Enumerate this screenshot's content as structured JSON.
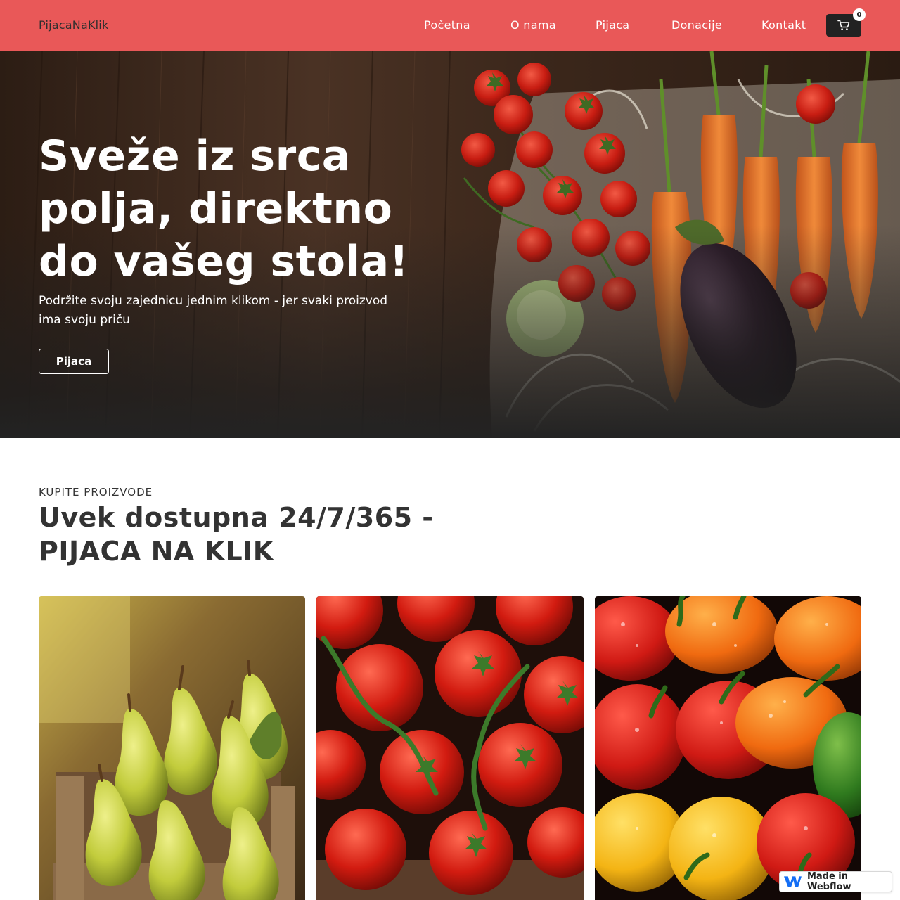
{
  "nav": {
    "brand": "PijacaNaKlik",
    "links": [
      "Početna",
      "O nama",
      "Pijaca",
      "Donacije",
      "Kontakt"
    ],
    "cart_count": "0",
    "accent": "#e95858"
  },
  "hero": {
    "title_line1": "Sveže iz srca",
    "title_line2": "polja, direktno",
    "title_line3": "do vašeg stola!",
    "subtitle_line1": "Podržite svoju zajednicu jednim klikom - jer svaki proizvod",
    "subtitle_line2": "ima svoju priču",
    "button": "Pijaca"
  },
  "products": {
    "eyebrow": "KUPITE PROIZVODE",
    "title_line1": "Uvek dostupna 24/7/365 -",
    "title_line2": "PIJACA NA KLIK",
    "cards": [
      "pears-photo",
      "tomatoes-photo",
      "peppers-photo"
    ]
  },
  "badge": {
    "label": "Made in Webflow"
  }
}
